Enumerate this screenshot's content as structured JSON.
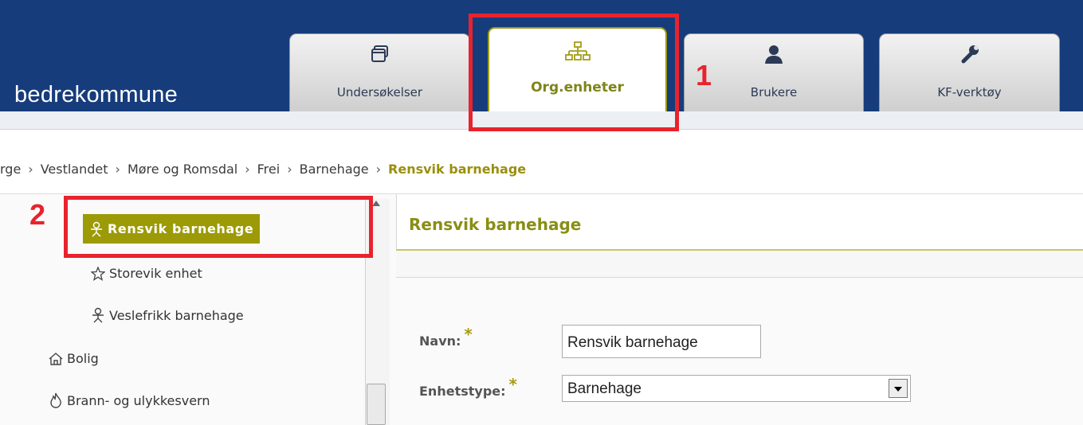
{
  "app": {
    "brand": "bedrekommune"
  },
  "tabs": [
    {
      "label": "Undersøkelser",
      "icon": "window-icon"
    },
    {
      "label": "Org.enheter",
      "icon": "org-chart-icon",
      "active": true
    },
    {
      "label": "Brukere",
      "icon": "user-icon"
    },
    {
      "label": "KF-verktøy",
      "icon": "wrench-icon"
    }
  ],
  "breadcrumb": {
    "items": [
      "rge",
      "Vestlandet",
      "Møre og Romsdal",
      "Frei",
      "Barnehage"
    ],
    "current": "Rensvik barnehage",
    "separator": "›"
  },
  "tree": {
    "items": [
      {
        "label": "Rensvik barnehage",
        "icon": "child-icon",
        "selected": true
      },
      {
        "label": "Storevik enhet",
        "icon": "star-icon"
      },
      {
        "label": "Veslefrikk barnehage",
        "icon": "child-icon"
      },
      {
        "label": "Bolig",
        "icon": "house-icon"
      },
      {
        "label": "Brann- og ulykkesvern",
        "icon": "fire-icon"
      }
    ]
  },
  "panel": {
    "title": "Rensvik barnehage"
  },
  "form": {
    "name_label": "Navn:",
    "name_value": "Rensvik barnehage",
    "type_label": "Enhetstype:",
    "type_value": "Barnehage",
    "required_mark": "*"
  },
  "annotations": {
    "one": "1",
    "two": "2"
  },
  "colors": {
    "header": "#163c7c",
    "accent": "#9c9a07",
    "highlight": "#e8232d"
  }
}
